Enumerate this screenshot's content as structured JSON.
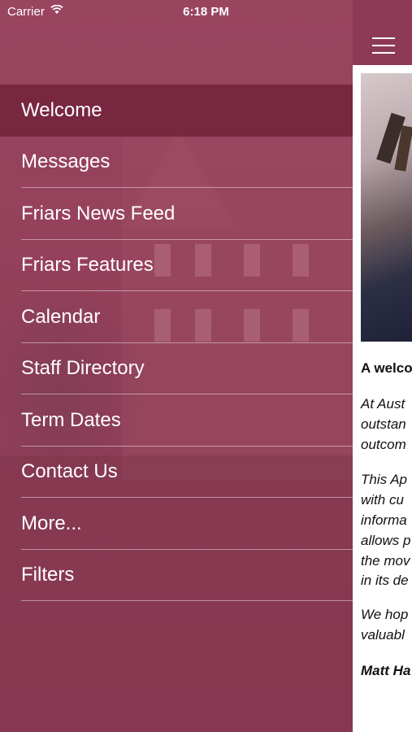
{
  "status_bar": {
    "carrier": "Carrier",
    "time": "6:18 PM"
  },
  "menu": {
    "items": [
      {
        "label": "Welcome",
        "active": true
      },
      {
        "label": "Messages"
      },
      {
        "label": "Friars News Feed"
      },
      {
        "label": "Friars Features"
      },
      {
        "label": "Calendar"
      },
      {
        "label": "Staff Directory"
      },
      {
        "label": "Term Dates"
      },
      {
        "label": "Contact Us"
      },
      {
        "label": "More..."
      },
      {
        "label": "Filters"
      }
    ]
  },
  "content": {
    "heading": "A welco",
    "para1": [
      "At Aust",
      "outstan",
      "outcom"
    ],
    "para2": [
      "This Ap",
      "with cu",
      "informa",
      "allows p",
      "the mov",
      "in its de"
    ],
    "para3": [
      "We hop",
      "valuabl"
    ],
    "signature": "Matt Ha"
  },
  "colors": {
    "accent": "#8e3a56",
    "active_item": "#6e1e37"
  }
}
